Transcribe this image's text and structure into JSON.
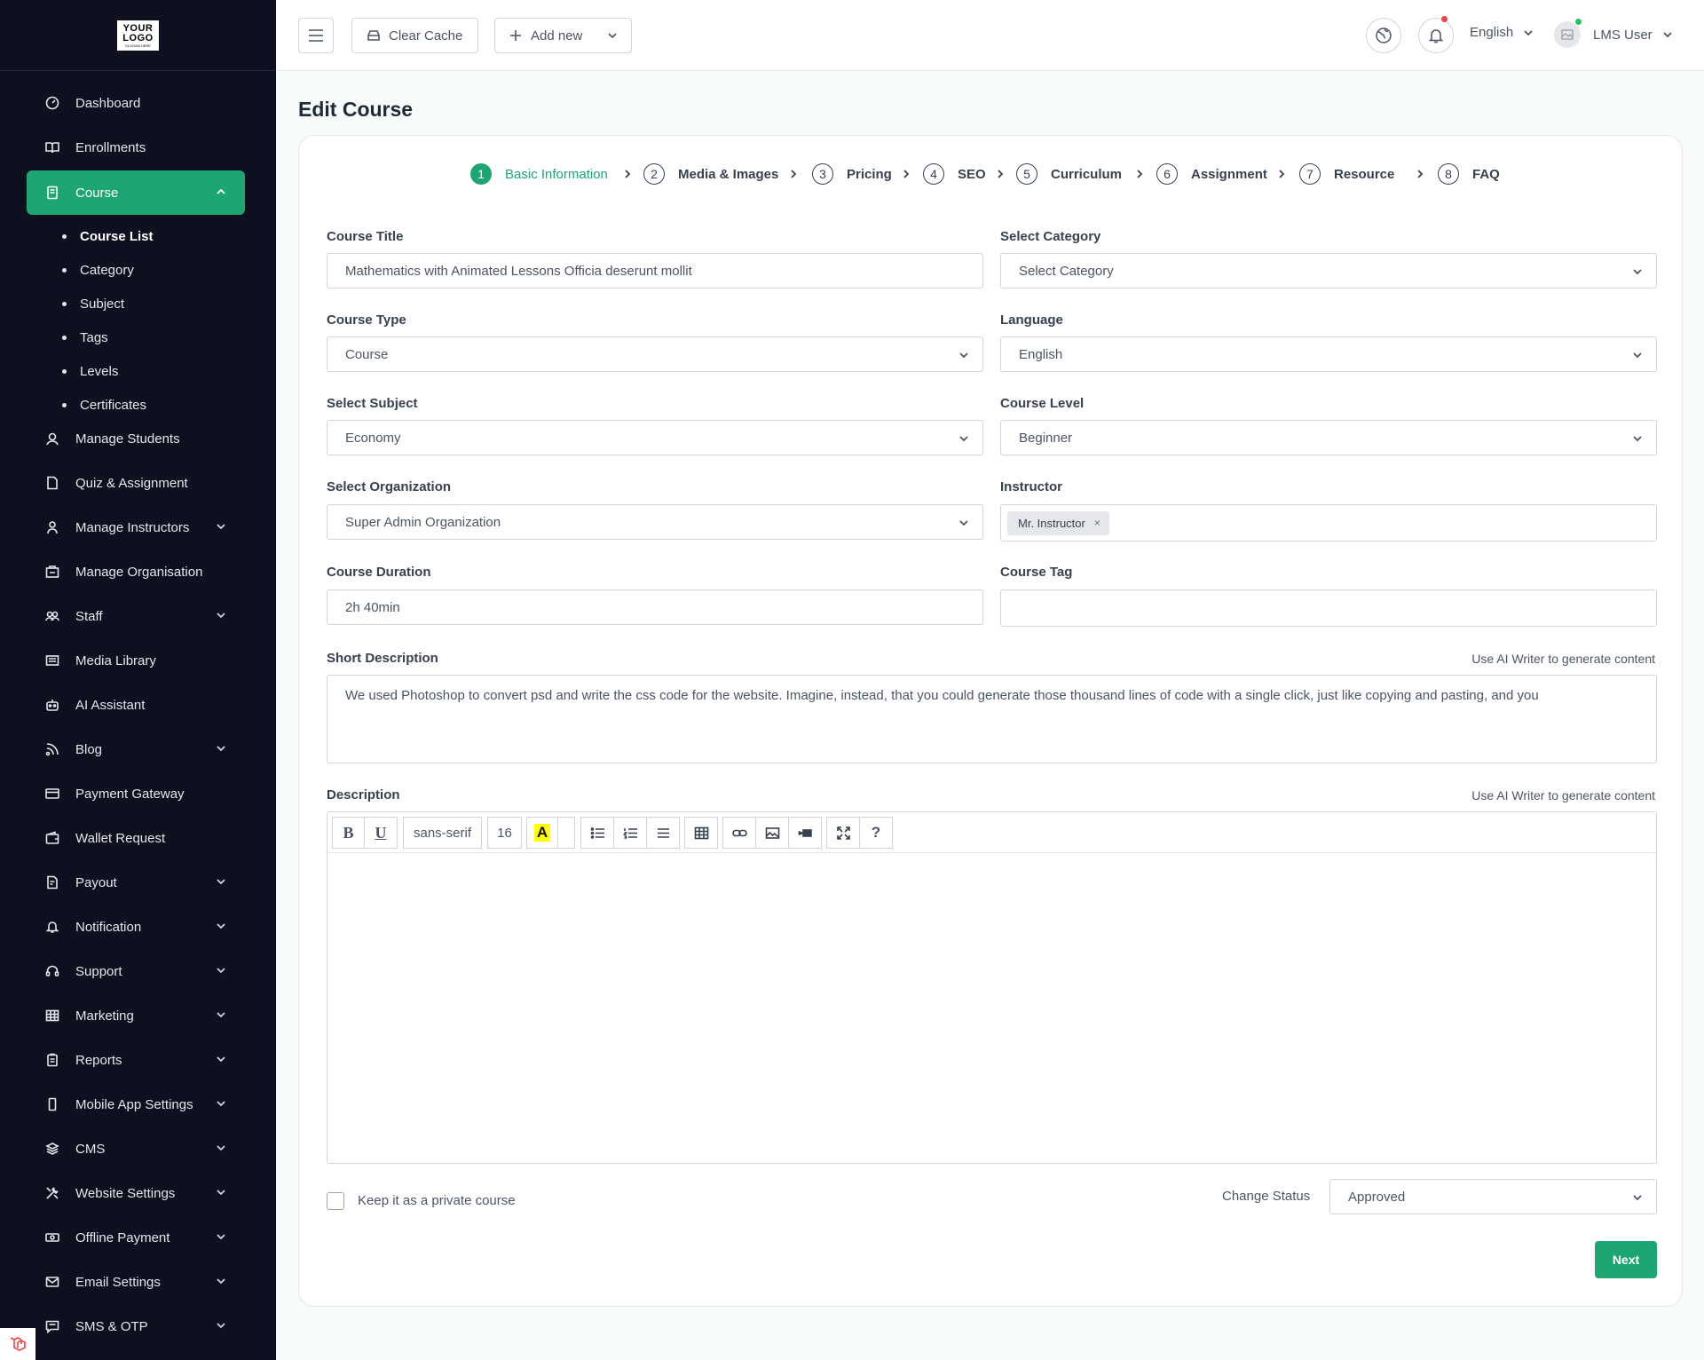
{
  "logo": {
    "line1": "YOUR",
    "line2": "LOGO",
    "tagline": "SLOGAN HERE"
  },
  "sidebar": {
    "items": [
      {
        "label": "Dashboard",
        "icon": "dashboard-gauge-icon",
        "expandable": false
      },
      {
        "label": "Enrollments",
        "icon": "book-open-icon",
        "expandable": false
      },
      {
        "label": "Course",
        "icon": "document-icon",
        "expandable": true,
        "active": true
      },
      {
        "label": "Manage Students",
        "icon": "student-icon",
        "expandable": false
      },
      {
        "label": "Quiz & Assignment",
        "icon": "file-icon",
        "expandable": false
      },
      {
        "label": "Manage Instructors",
        "icon": "user-icon",
        "expandable": true
      },
      {
        "label": "Manage Organisation",
        "icon": "building-icon",
        "expandable": false
      },
      {
        "label": "Staff",
        "icon": "users-icon",
        "expandable": true
      },
      {
        "label": "Media Library",
        "icon": "images-icon",
        "expandable": false
      },
      {
        "label": "AI Assistant",
        "icon": "robot-icon",
        "expandable": false
      },
      {
        "label": "Blog",
        "icon": "rss-icon",
        "expandable": true
      },
      {
        "label": "Payment Gateway",
        "icon": "credit-card-icon",
        "expandable": false
      },
      {
        "label": "Wallet Request",
        "icon": "wallet-icon",
        "expandable": false
      },
      {
        "label": "Payout",
        "icon": "payout-icon",
        "expandable": true
      },
      {
        "label": "Notification",
        "icon": "bell-icon",
        "expandable": true
      },
      {
        "label": "Support",
        "icon": "headset-icon",
        "expandable": true
      },
      {
        "label": "Marketing",
        "icon": "grid-icon",
        "expandable": true
      },
      {
        "label": "Reports",
        "icon": "clipboard-icon",
        "expandable": true
      },
      {
        "label": "Mobile App Settings",
        "icon": "mobile-icon",
        "expandable": true
      },
      {
        "label": "CMS",
        "icon": "layers-icon",
        "expandable": true
      },
      {
        "label": "Website Settings",
        "icon": "tools-icon",
        "expandable": true
      },
      {
        "label": "Offline Payment",
        "icon": "cash-icon",
        "expandable": true
      },
      {
        "label": "Email Settings",
        "icon": "mail-icon",
        "expandable": true
      },
      {
        "label": "SMS & OTP",
        "icon": "message-icon",
        "expandable": true
      }
    ],
    "course_sub": [
      "Course List",
      "Category",
      "Subject",
      "Tags",
      "Levels",
      "Certificates"
    ]
  },
  "topbar": {
    "clear_cache": "Clear Cache",
    "add_new": "Add new",
    "language": "English",
    "user": "LMS User"
  },
  "page": {
    "title": "Edit Course"
  },
  "steps": [
    {
      "num": "1",
      "label": "Basic Information"
    },
    {
      "num": "2",
      "label": "Media & Images"
    },
    {
      "num": "3",
      "label": "Pricing"
    },
    {
      "num": "4",
      "label": "SEO"
    },
    {
      "num": "5",
      "label": "Curriculum"
    },
    {
      "num": "6",
      "label": "Assignment"
    },
    {
      "num": "7",
      "label": "Resource"
    },
    {
      "num": "8",
      "label": "FAQ"
    }
  ],
  "form": {
    "course_title": {
      "label": "Course Title",
      "value": "Mathematics with Animated Lessons Officia deserunt mollit"
    },
    "category": {
      "label": "Select Category",
      "value": "Select Category"
    },
    "course_type": {
      "label": "Course Type",
      "value": "Course"
    },
    "language": {
      "label": "Language",
      "value": "English"
    },
    "subject": {
      "label": "Select Subject",
      "value": "Economy"
    },
    "level": {
      "label": "Course Level",
      "value": "Beginner"
    },
    "organization": {
      "label": "Select Organization",
      "value": "Super Admin Organization"
    },
    "instructor": {
      "label": "Instructor",
      "chip": "Mr. Instructor",
      "remove": "×"
    },
    "duration": {
      "label": "Course Duration",
      "value": "2h 40min"
    },
    "tag": {
      "label": "Course Tag",
      "value": ""
    },
    "short_description": {
      "label": "Short Description",
      "ai_hint": "Use AI Writer to generate content",
      "value": "We used Photoshop to convert psd and write the css code for the website. Imagine, instead, that you could generate those thousand lines of code with a single click, just like copying and pasting, and you"
    },
    "description": {
      "label": "Description",
      "ai_hint": "Use AI Writer to generate content",
      "font": "sans-serif",
      "size": "16",
      "bold": "B",
      "underline": "U",
      "color": "A",
      "help": "?"
    },
    "private": {
      "label": "Keep it as a private course"
    },
    "status": {
      "label": "Change Status",
      "value": "Approved"
    },
    "next": "Next"
  },
  "colors": {
    "accent": "#1ea672",
    "sidebar_bg": "#0e0f1f",
    "notif_dot": "#ef4444",
    "online_dot": "#22c55e"
  }
}
